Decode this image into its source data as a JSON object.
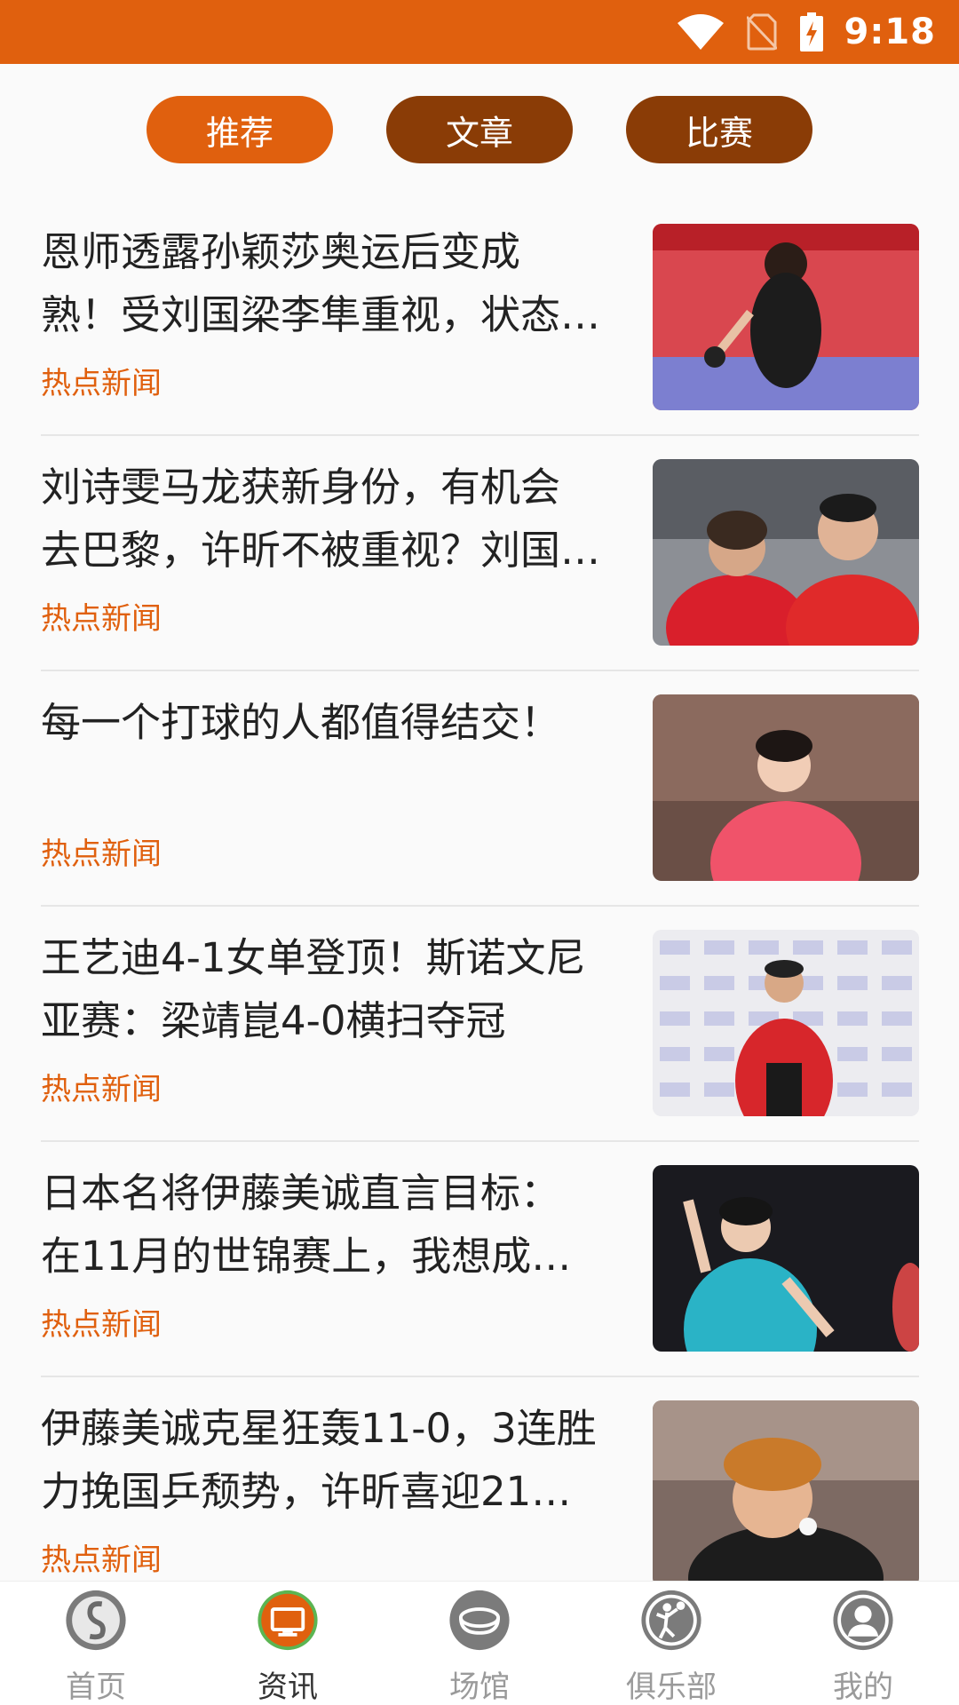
{
  "status_bar": {
    "time": "9:18",
    "icons": [
      "wifi-icon",
      "no-sim-icon",
      "battery-charging-icon"
    ]
  },
  "tabs": [
    {
      "label": "推荐",
      "active": true
    },
    {
      "label": "文章",
      "active": false
    },
    {
      "label": "比赛",
      "active": false
    }
  ],
  "news": [
    {
      "title_lines": [
        "恩师透露孙颖莎奥运后变成",
        "熟！受刘国梁李隼重视，状态…"
      ],
      "tag": "热点新闻"
    },
    {
      "title_lines": [
        "刘诗雯马龙获新身份，有机会",
        "去巴黎，许昕不被重视？刘国…"
      ],
      "tag": "热点新闻"
    },
    {
      "title_lines": [
        "每一个打球的人都值得结交！"
      ],
      "tag": "热点新闻"
    },
    {
      "title_lines": [
        "王艺迪4-1女单登顶！斯诺文尼",
        "亚赛：梁靖崑4-0横扫夺冠"
      ],
      "tag": "热点新闻"
    },
    {
      "title_lines": [
        "日本名将伊藤美诚直言目标：",
        "在11月的世锦赛上，我想成…"
      ],
      "tag": "热点新闻"
    },
    {
      "title_lines": [
        "伊藤美诚克星狂轰11-0，3连胜",
        "力挽国乒颓势，许昕喜迎21…"
      ],
      "tag": "热点新闻"
    }
  ],
  "bottom_nav": [
    {
      "label": "首页",
      "icon": "home-icon",
      "active": false
    },
    {
      "label": "资讯",
      "icon": "news-icon",
      "active": true
    },
    {
      "label": "场馆",
      "icon": "venue-icon",
      "active": false
    },
    {
      "label": "俱乐部",
      "icon": "club-icon",
      "active": false
    },
    {
      "label": "我的",
      "icon": "profile-icon",
      "active": false
    }
  ],
  "colors": {
    "accent": "#e0600e",
    "tab_inactive": "#8a3c06",
    "tag": "#e0600e"
  }
}
